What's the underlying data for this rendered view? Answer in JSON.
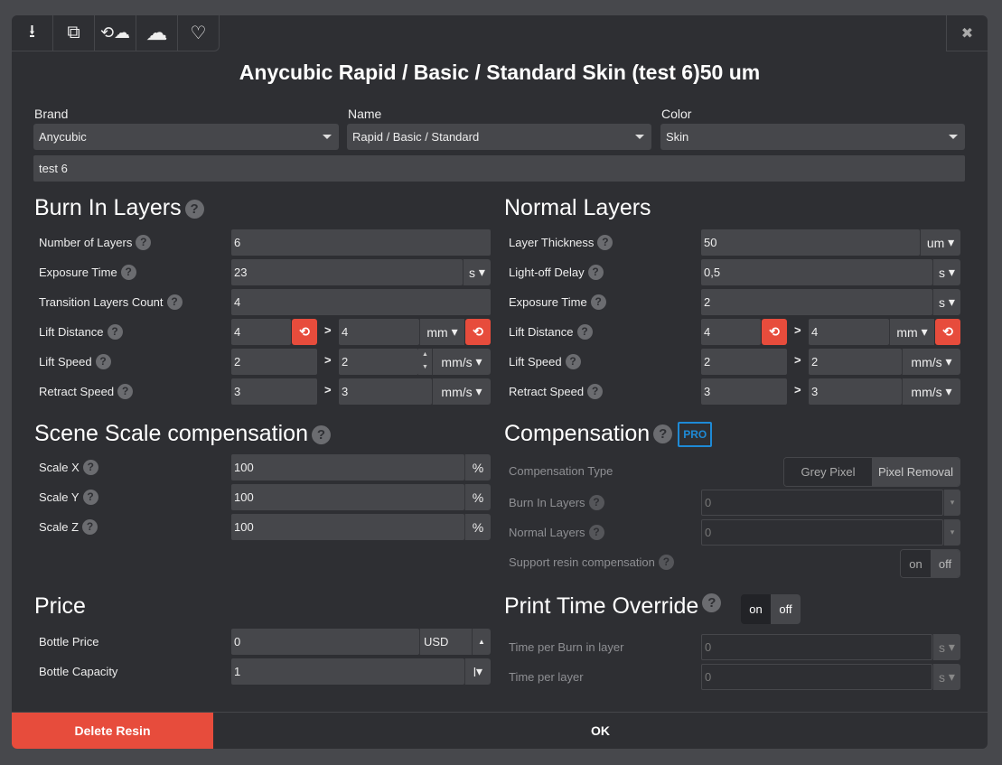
{
  "toolbar": {
    "icons": [
      "download-icon",
      "copy-icon",
      "cloud-sync-icon",
      "cloud-icon",
      "heart-icon"
    ],
    "close": "✖"
  },
  "title": "Anycubic Rapid / Basic / Standard Skin (test 6)50 um",
  "brand": {
    "label": "Brand",
    "value": "Anycubic"
  },
  "name": {
    "label": "Name",
    "value": "Rapid / Basic / Standard"
  },
  "color": {
    "label": "Color",
    "value": "Skin"
  },
  "custom_name": "test 6",
  "burn": {
    "title": "Burn In Layers",
    "layers": {
      "label": "Number of Layers",
      "value": "6"
    },
    "exposure": {
      "label": "Exposure Time",
      "value": "23",
      "unit": "s"
    },
    "transition": {
      "label": "Transition Layers Count",
      "value": "4"
    },
    "lift_distance": {
      "label": "Lift Distance",
      "v1": "4",
      "v2": "4",
      "unit": "mm"
    },
    "lift_speed": {
      "label": "Lift Speed",
      "v1": "2",
      "v2": "2",
      "unit": "mm/s"
    },
    "retract": {
      "label": "Retract Speed",
      "v1": "3",
      "v2": "3",
      "unit": "mm/s"
    }
  },
  "normal": {
    "title": "Normal Layers",
    "thickness": {
      "label": "Layer Thickness",
      "value": "50",
      "unit": "um"
    },
    "lightoff": {
      "label": "Light-off Delay",
      "value": "0,5",
      "unit": "s"
    },
    "exposure": {
      "label": "Exposure Time",
      "value": "2",
      "unit": "s"
    },
    "lift_distance": {
      "label": "Lift Distance",
      "v1": "4",
      "v2": "4",
      "unit": "mm"
    },
    "lift_speed": {
      "label": "Lift Speed",
      "v1": "2",
      "v2": "2",
      "unit": "mm/s"
    },
    "retract": {
      "label": "Retract Speed",
      "v1": "3",
      "v2": "3",
      "unit": "mm/s"
    }
  },
  "scale": {
    "title": "Scene Scale compensation",
    "x": {
      "label": "Scale X",
      "value": "100"
    },
    "y": {
      "label": "Scale Y",
      "value": "100"
    },
    "z": {
      "label": "Scale Z",
      "value": "100"
    },
    "unit": "%"
  },
  "comp": {
    "title": "Compensation",
    "badge": "PRO",
    "type_label": "Compensation Type",
    "type_options": [
      "Grey Pixel",
      "Pixel Removal"
    ],
    "burn": {
      "label": "Burn In Layers",
      "value": "0"
    },
    "normal": {
      "label": "Normal Layers",
      "value": "0"
    },
    "support": {
      "label": "Support resin compensation",
      "on": "on",
      "off": "off"
    }
  },
  "price": {
    "title": "Price",
    "bottle_price": {
      "label": "Bottle Price",
      "value": "0",
      "unit": "USD"
    },
    "capacity": {
      "label": "Bottle Capacity",
      "value": "1",
      "unit": "l"
    }
  },
  "override": {
    "title": "Print Time Override",
    "on": "on",
    "off": "off",
    "burn": {
      "label": "Time per Burn in layer",
      "value": "0",
      "unit": "s"
    },
    "layer": {
      "label": "Time per layer",
      "value": "0",
      "unit": "s"
    }
  },
  "footer": {
    "delete": "Delete Resin",
    "ok": "OK"
  },
  "gt": ">",
  "q": "?",
  "reset": "⟲"
}
